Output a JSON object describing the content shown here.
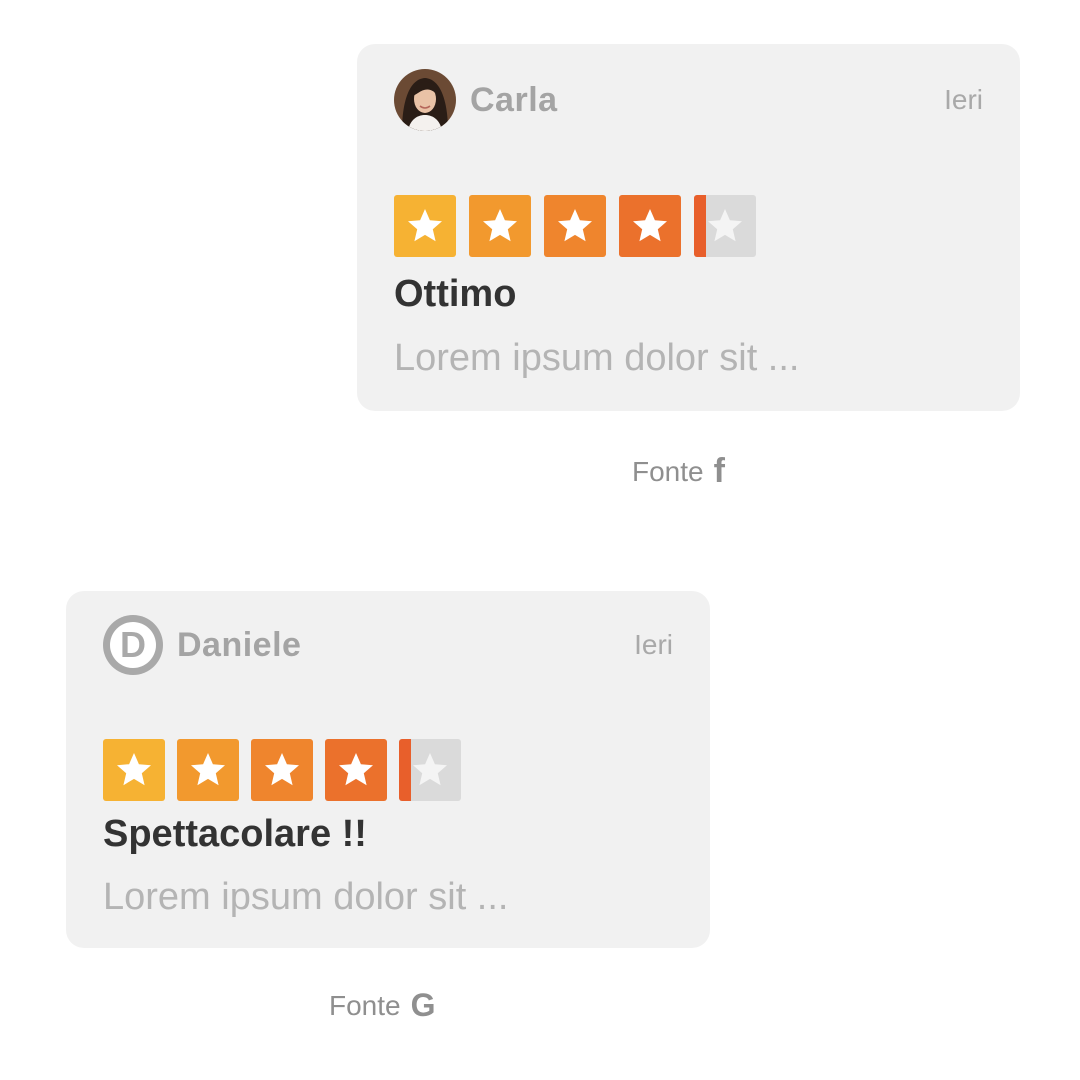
{
  "colors": {
    "card_background": "#f1f1f1",
    "star_gradient": [
      "#f6b233",
      "#f2992e",
      "#ef852d",
      "#eb712c",
      "#e85f2b"
    ],
    "star_empty": "#dadada",
    "title_text": "#333333",
    "body_text": "#b4b4b4",
    "meta_text": "#a9a9a9"
  },
  "reviews": [
    {
      "reviewer": {
        "name": "Carla",
        "avatar": "photo-avatar"
      },
      "date": "Ieri",
      "rating": 4.2,
      "max_rating": 5,
      "title": "Ottimo",
      "body": "Lorem ipsum dolor sit ...",
      "source": {
        "label": "Fonte",
        "icon": "facebook-icon",
        "glyph": "f"
      }
    },
    {
      "reviewer": {
        "name": "Daniele",
        "initial": "D",
        "avatar": "initial-avatar"
      },
      "date": "Ieri",
      "rating": 4.2,
      "max_rating": 5,
      "title": "Spettacolare !!",
      "body": "Lorem ipsum dolor sit ...",
      "source": {
        "label": "Fonte",
        "icon": "google-icon",
        "glyph": "G"
      }
    }
  ]
}
